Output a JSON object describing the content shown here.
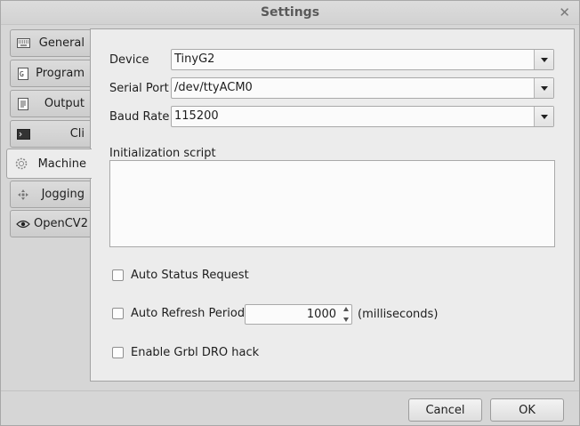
{
  "window": {
    "title": "Settings"
  },
  "tabs": [
    {
      "label": "General",
      "icon": "keyboard-icon"
    },
    {
      "label": "Program",
      "icon": "program-file-icon"
    },
    {
      "label": "Output",
      "icon": "document-icon"
    },
    {
      "label": "Cli",
      "icon": "terminal-icon"
    },
    {
      "label": "Machine",
      "icon": "machine-gear-icon",
      "active": true
    },
    {
      "label": "Jogging",
      "icon": "move-arrows-icon"
    },
    {
      "label": "OpenCV2",
      "icon": "eye-icon"
    }
  ],
  "machine": {
    "device": {
      "label": "Device",
      "value": "TinyG2"
    },
    "serial_port": {
      "label": "Serial Port",
      "value": "/dev/ttyACM0"
    },
    "baud_rate": {
      "label": "Baud Rate",
      "value": "115200"
    },
    "init_script": {
      "label": "Initialization script",
      "value": ""
    },
    "auto_status": {
      "label": "Auto Status Request",
      "checked": false
    },
    "auto_refresh": {
      "label": "Auto Refresh Period",
      "checked": false,
      "value": "1000",
      "unit": "(milliseconds)"
    },
    "grbl_hack": {
      "label": "Enable Grbl DRO hack",
      "checked": false
    }
  },
  "footer": {
    "cancel": "Cancel",
    "ok": "OK"
  }
}
